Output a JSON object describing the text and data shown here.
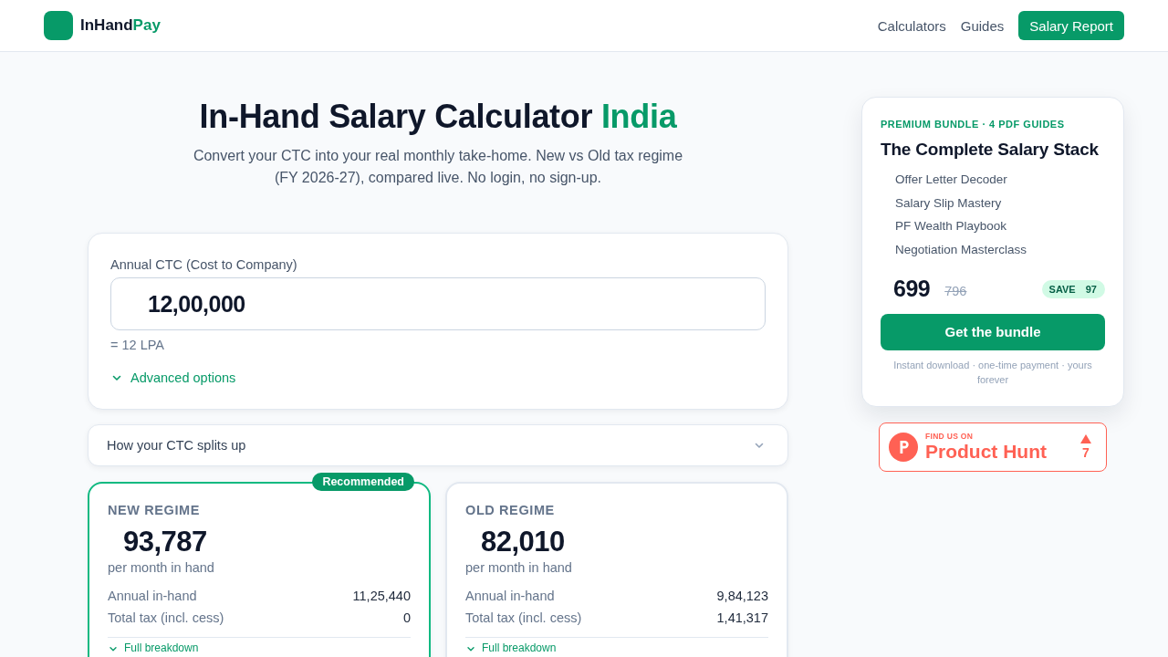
{
  "header": {
    "logo": {
      "name": "InHand",
      "highlight": "Pay"
    },
    "nav": [
      {
        "label": "Calculators"
      },
      {
        "label": "Guides"
      }
    ],
    "cta": "Salary Report"
  },
  "hero": {
    "title": "In-Hand Salary Calculator",
    "title_highlight": "India",
    "subtitle": "Convert your CTC into your real monthly take-home. New vs Old tax regime (FY 2026-27), compared live. No login, no sign-up."
  },
  "ctc_card": {
    "label": "Annual CTC (Cost to Company)",
    "value": "12,00,000",
    "hint": "= 12 LPA",
    "advanced": {
      "label": "Advanced options",
      "expanded": false
    }
  },
  "split_section": {
    "label": "How your CTC splits up",
    "expanded": false
  },
  "regimes": [
    {
      "label": "NEW REGIME",
      "recommended": true,
      "badge": "Recommended",
      "amount": "93,787",
      "caption": "per month in hand",
      "rows": [
        {
          "label": "Annual in-hand",
          "value": "11,25,440"
        },
        {
          "label": "Total tax (incl. cess)",
          "value": "0"
        }
      ],
      "breakdown": {
        "label": "Full breakdown",
        "expanded": false
      }
    },
    {
      "label": "OLD REGIME",
      "recommended": false,
      "amount": "82,010",
      "caption": "per month in hand",
      "rows": [
        {
          "label": "Annual in-hand",
          "value": "9,84,123"
        },
        {
          "label": "Total tax (incl. cess)",
          "value": "1,41,317"
        }
      ],
      "breakdown": {
        "label": "Full breakdown",
        "expanded": false
      }
    }
  ],
  "bundle": {
    "eyebrow": "PREMIUM BUNDLE · 4 PDF GUIDES",
    "title": "The Complete Salary Stack",
    "items": [
      "Offer Letter Decoder",
      "Salary Slip Mastery",
      "PF Wealth Playbook",
      "Negotiation Masterclass"
    ],
    "price": "699",
    "old_price": "796",
    "save": "SAVE 97",
    "button": "Get the bundle",
    "note": "Instant download · one-time payment · yours forever"
  },
  "product_hunt": {
    "kicker": "FIND US ON",
    "name": "Product Hunt",
    "votes": "7"
  }
}
